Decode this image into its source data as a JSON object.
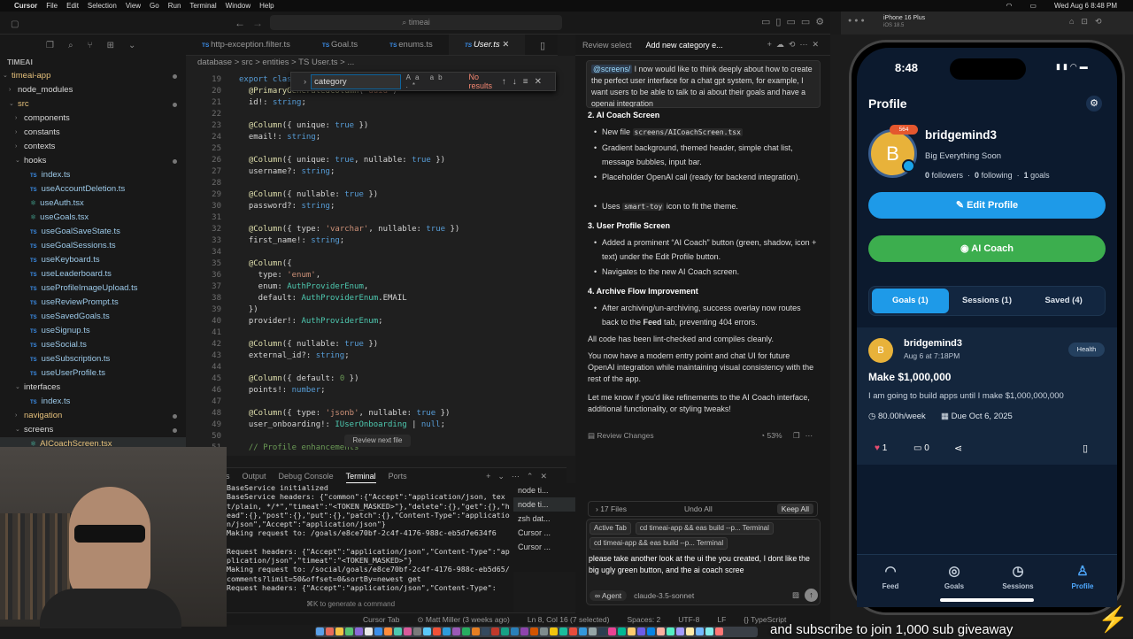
{
  "menubar": {
    "app": "Cursor",
    "items": [
      "File",
      "Edit",
      "Selection",
      "View",
      "Go",
      "Run",
      "Terminal",
      "Window",
      "Help"
    ],
    "datetime": "Wed Aug 6  8:48 PM"
  },
  "window": {
    "search": "timeai"
  },
  "explorer": {
    "root": "TIMEAI",
    "rows": [
      {
        "t": "timeai-app",
        "k": "fold",
        "d": 1,
        "open": true
      },
      {
        "t": "node_modules",
        "k": "fold",
        "d": 2,
        "open": false
      },
      {
        "t": "src",
        "k": "fold",
        "d": 2,
        "open": true
      },
      {
        "t": "components",
        "k": "fold",
        "d": 3,
        "open": false
      },
      {
        "t": "constants",
        "k": "fold",
        "d": 3,
        "open": false
      },
      {
        "t": "contexts",
        "k": "fold",
        "d": 3,
        "open": false
      },
      {
        "t": "hooks",
        "k": "fold",
        "d": 3,
        "open": true
      },
      {
        "t": "index.ts",
        "k": "ts",
        "d": 4
      },
      {
        "t": "useAccountDeletion.ts",
        "k": "ts",
        "d": 4
      },
      {
        "t": "useAuth.tsx",
        "k": "tsx",
        "d": 4
      },
      {
        "t": "useGoals.tsx",
        "k": "tsx",
        "d": 4
      },
      {
        "t": "useGoalSaveState.ts",
        "k": "ts",
        "d": 4
      },
      {
        "t": "useGoalSessions.ts",
        "k": "ts",
        "d": 4
      },
      {
        "t": "useKeyboard.ts",
        "k": "ts",
        "d": 4
      },
      {
        "t": "useLeaderboard.ts",
        "k": "ts",
        "d": 4
      },
      {
        "t": "useProfileImageUpload.ts",
        "k": "ts",
        "d": 4
      },
      {
        "t": "useReviewPrompt.ts",
        "k": "ts",
        "d": 4
      },
      {
        "t": "useSavedGoals.ts",
        "k": "ts",
        "d": 4
      },
      {
        "t": "useSignup.ts",
        "k": "ts",
        "d": 4
      },
      {
        "t": "useSocial.ts",
        "k": "ts",
        "d": 4
      },
      {
        "t": "useSubscription.ts",
        "k": "ts",
        "d": 4
      },
      {
        "t": "useUserProfile.ts",
        "k": "ts",
        "d": 4
      },
      {
        "t": "interfaces",
        "k": "fold",
        "d": 3,
        "open": true
      },
      {
        "t": "index.ts",
        "k": "ts",
        "d": 4
      },
      {
        "t": "navigation",
        "k": "fold",
        "d": 3,
        "open": false
      },
      {
        "t": "screens",
        "k": "fold",
        "d": 3,
        "open": true
      },
      {
        "t": "AICoachScreen.tsx",
        "k": "tsx",
        "d": 4
      }
    ]
  },
  "tabs": [
    "http-exception.filter.ts",
    "Goal.ts",
    "enums.ts",
    "User.ts"
  ],
  "breadcrumb": "database  >  src  >  entities  >  TS User.ts  >  ...",
  "find": {
    "query": "category",
    "result": "No results"
  },
  "code": [
    {
      "n": "19",
      "s": [
        [
          "kw",
          "export class"
        ],
        [
          "",
          "  "
        ]
      ]
    },
    {
      "n": "20",
      "s": [
        [
          "dec",
          "  @PrimaryGeneratedColumn"
        ],
        [
          "",
          "("
        ],
        [
          "str",
          "'uuid'"
        ],
        [
          "",
          ")"
        ]
      ]
    },
    {
      "n": "21",
      "s": [
        [
          "",
          "  id!: "
        ],
        [
          "kw",
          "string"
        ],
        [
          "",
          ";"
        ]
      ]
    },
    {
      "n": "22",
      "s": []
    },
    {
      "n": "23",
      "s": [
        [
          "dec",
          "  @Column"
        ],
        [
          "",
          "({ unique: "
        ],
        [
          "kw",
          "true"
        ],
        [
          "",
          " })"
        ]
      ]
    },
    {
      "n": "24",
      "s": [
        [
          "",
          "  email!: "
        ],
        [
          "kw",
          "string"
        ],
        [
          "",
          ";"
        ]
      ]
    },
    {
      "n": "25",
      "s": []
    },
    {
      "n": "26",
      "s": [
        [
          "dec",
          "  @Column"
        ],
        [
          "",
          "({ unique: "
        ],
        [
          "kw",
          "true"
        ],
        [
          "",
          ", nullable: "
        ],
        [
          "kw",
          "true"
        ],
        [
          "",
          " })"
        ]
      ]
    },
    {
      "n": "27",
      "s": [
        [
          "",
          "  username?: "
        ],
        [
          "kw",
          "string"
        ],
        [
          "",
          ";"
        ]
      ]
    },
    {
      "n": "28",
      "s": []
    },
    {
      "n": "29",
      "s": [
        [
          "dec",
          "  @Column"
        ],
        [
          "",
          "({ nullable: "
        ],
        [
          "kw",
          "true"
        ],
        [
          "",
          " })"
        ]
      ]
    },
    {
      "n": "30",
      "s": [
        [
          "",
          "  password?: "
        ],
        [
          "kw",
          "string"
        ],
        [
          "",
          ";"
        ]
      ]
    },
    {
      "n": "31",
      "s": []
    },
    {
      "n": "32",
      "s": [
        [
          "dec",
          "  @Column"
        ],
        [
          "",
          "({ type: "
        ],
        [
          "str",
          "'varchar'"
        ],
        [
          "",
          ", nullable: "
        ],
        [
          "kw",
          "true"
        ],
        [
          "",
          " })"
        ]
      ]
    },
    {
      "n": "33",
      "s": [
        [
          "",
          "  first_name!: "
        ],
        [
          "kw",
          "string"
        ],
        [
          "",
          ";"
        ]
      ]
    },
    {
      "n": "34",
      "s": []
    },
    {
      "n": "35",
      "s": [
        [
          "dec",
          "  @Column"
        ],
        [
          "",
          "({"
        ]
      ]
    },
    {
      "n": "36",
      "s": [
        [
          "",
          "    type: "
        ],
        [
          "str",
          "'enum'"
        ],
        [
          "",
          ","
        ]
      ]
    },
    {
      "n": "37",
      "s": [
        [
          "",
          "    enum: "
        ],
        [
          "ty",
          "AuthProviderEnum"
        ],
        [
          "",
          ","
        ]
      ]
    },
    {
      "n": "38",
      "s": [
        [
          "",
          "    default: "
        ],
        [
          "ty",
          "AuthProviderEnum"
        ],
        [
          "",
          ".EMAIL"
        ]
      ]
    },
    {
      "n": "39",
      "s": [
        [
          "",
          "  })"
        ]
      ]
    },
    {
      "n": "40",
      "s": [
        [
          "",
          "  provider!: "
        ],
        [
          "ty",
          "AuthProviderEnum"
        ],
        [
          "",
          ";"
        ]
      ]
    },
    {
      "n": "41",
      "s": []
    },
    {
      "n": "42",
      "s": [
        [
          "dec",
          "  @Column"
        ],
        [
          "",
          "({ nullable: "
        ],
        [
          "kw",
          "true"
        ],
        [
          "",
          " })"
        ]
      ]
    },
    {
      "n": "43",
      "s": [
        [
          "",
          "  external_id?: "
        ],
        [
          "kw",
          "string"
        ],
        [
          "",
          ";"
        ]
      ]
    },
    {
      "n": "44",
      "s": []
    },
    {
      "n": "45",
      "s": [
        [
          "dec",
          "  @Column"
        ],
        [
          "",
          "({ default: "
        ],
        [
          "cm",
          "0"
        ],
        [
          "",
          " })"
        ]
      ]
    },
    {
      "n": "46",
      "s": [
        [
          "",
          "  points!: "
        ],
        [
          "kw",
          "number"
        ],
        [
          "",
          ";"
        ]
      ]
    },
    {
      "n": "47",
      "s": []
    },
    {
      "n": "48",
      "s": [
        [
          "dec",
          "  @Column"
        ],
        [
          "",
          "({ type: "
        ],
        [
          "str",
          "'jsonb'"
        ],
        [
          "",
          ", nullable: "
        ],
        [
          "kw",
          "true"
        ],
        [
          "",
          " })"
        ]
      ]
    },
    {
      "n": "49",
      "s": [
        [
          "",
          "  user_onboarding!: "
        ],
        [
          "ty",
          "IUserOnboarding"
        ],
        [
          "",
          " | "
        ],
        [
          "kw",
          "null"
        ],
        [
          "",
          ";"
        ]
      ]
    },
    {
      "n": "50",
      "s": []
    },
    {
      "n": "51",
      "s": [
        [
          "cm",
          "  // Profile enhancements"
        ]
      ]
    }
  ],
  "review_next": "Review next file",
  "panel": {
    "tabs": [
      "ns",
      "Output",
      "Debug Console",
      "Terminal",
      "Ports"
    ],
    "active": 3
  },
  "terminal_lines": [
    "BaseService initialized",
    "BaseService headers: {\"common\":{\"Accept\":\"application/json, text/plain, */*\",\"timeat\":\"<TOKEN_MASKED>\"},\"delete\":{},\"get\":{},\"head\":{},\"post\":{},\"put\":{},\"patch\":{},\"Content-Type\":\"application/json\",\"Accept\":\"application/json\"}",
    "Making request to: /goals/e8ce70bf-2c4f-4176-988c-eb5d7e634f6",
    "",
    "Request headers: {\"Accept\":\"application/json\",\"Content-Type\":\"application/json\",\"timeat\":\"<TOKEN_MASKED>\"}",
    "Making request to: /social/goals/e8ce70bf-2c4f-4176-988c-eb5d65/comments?limit=50&offset=0&sortBy=newest get",
    "Request headers: {\"Accept\":\"application/json\",\"Content-Type\":"
  ],
  "term_list": [
    "node  ti...",
    "node  ti...",
    "zsh  dat...",
    "Cursor ...",
    "Cursor ..."
  ],
  "term_hint": "⌘K to generate a command",
  "status": [
    "Cursor Tab",
    "⊙ Matt Miller (3 weeks ago)",
    "Ln 8, Col 16 (7 selected)",
    "Spaces: 2",
    "UTF-8",
    "LF",
    "{} TypeScript"
  ],
  "chat": {
    "tabs": [
      "Review select",
      "Add new category e..."
    ],
    "user_mention": "@screens/",
    "user_msg": " I now would like to think deeply about how to create the perfect user interface for a chat gpt system, for example, I want users to be able to talk to ai about their goals and have a openai integration",
    "h2": "2. AI Coach Screen",
    "b2": [
      "New file ",
      "Gradient background, themed header, simple chat list, message bubbles, input bar.",
      "Placeholder OpenAI call (ready for backend integration).",
      "Uses "
    ],
    "b2code1": "screens/AICoachScreen.tsx",
    "b2code2": "smart-toy",
    "b2tail": " icon to fit the theme.",
    "h3": "3. User Profile Screen",
    "b3": [
      "Added a prominent “AI Coach” button (green, shadow, icon + text) under the Edit Profile button.",
      "Navigates to the new AI Coach screen."
    ],
    "h4": "4. Archive Flow Improvement",
    "b4a": "After archiving/un-archiving, success overlay now routes back to the ",
    "b4bold": "Feed",
    "b4b": " tab, preventing 404 errors.",
    "p1": "All code has been lint-checked and compiles cleanly.",
    "p2": "You now have a modern entry point and chat UI for future OpenAI integration while maintaining visual consistency with the rest of the app.",
    "p3": "Let me know if you'd like refinements to the AI Coach interface, additional functionality, or styling tweaks!",
    "review_changes": "Review Changes",
    "progress": "53%",
    "files": "17 Files",
    "undo": "Undo All",
    "keep": "Keep All",
    "chip1": "Active Tab",
    "chip2": "cd timeai-app && eas build --p... Terminal",
    "chip3": "cd timeai-app && eas build --p... Terminal",
    "input": "please take another look at the ui the you created, I dont like the big ugly green button, and the ai coach scree",
    "agent": "Agent",
    "model": "claude-3.5-sonnet"
  },
  "sim": {
    "device": "iPhone 16 Plus",
    "os": "iOS 18.5"
  },
  "phone": {
    "time": "8:48",
    "title": "Profile",
    "username": "bridgemind3",
    "tagline": "Big Everything Soon",
    "followers": "0",
    "followers_label": "followers",
    "following": "0",
    "following_label": "following",
    "goals": "1",
    "goals_label": "goals",
    "badge": "564",
    "avatar_letter": "B",
    "edit": "Edit Profile",
    "ai": "AI Coach",
    "segments": [
      "Goals (1)",
      "Sessions (1)",
      "Saved (4)"
    ],
    "card": {
      "user": "bridgemind3",
      "date": "Aug 6 at 7:18PM",
      "tag": "Health",
      "title": "Make $1,000,000",
      "desc": "I am going to build apps until I make $1,000,000,000",
      "rate": "80.00h/week",
      "due": "Due Oct 6, 2025",
      "likes": "1",
      "comments": "0"
    },
    "tabbar": [
      "Feed",
      "Goals",
      "Sessions",
      "Profile"
    ]
  },
  "ticker": "and subscribe to join 1,000 sub giveaway"
}
